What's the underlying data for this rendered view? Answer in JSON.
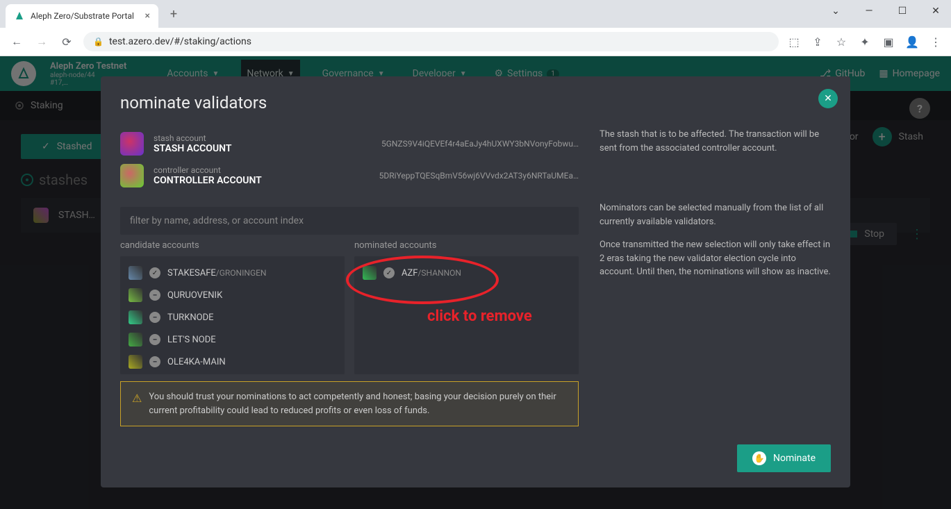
{
  "browser": {
    "tab_title": "Aleph Zero/Substrate Portal",
    "url": "test.azero.dev/#/staking/actions"
  },
  "header": {
    "network_name": "Aleph Zero Testnet",
    "node_name": "aleph-node/44",
    "block_number": "#17,…",
    "nav": {
      "accounts": "Accounts",
      "network": "Network",
      "governance": "Governance",
      "developer": "Developer",
      "settings": "Settings",
      "settings_badge": "1"
    },
    "right": {
      "github": "GitHub",
      "homepage": "Homepage"
    }
  },
  "subnav": {
    "staking": "Staking"
  },
  "page": {
    "stashed_btn": "Stashed",
    "stash_btn": "Stash",
    "or_label": "or",
    "stashes_label": "stashes",
    "stash_name": "STASH…",
    "stop_btn": "Stop"
  },
  "modal": {
    "title": "nominate validators",
    "stash": {
      "sublabel": "stash account",
      "mainlabel": "STASH ACCOUNT",
      "addr": "5GNZS9V4iQEVEf4r4aEaJy4hUXWY3bNVonyFobwu…"
    },
    "controller": {
      "sublabel": "controller account",
      "mainlabel": "CONTROLLER ACCOUNT",
      "addr": "5DRiYeppTQESqBmV56wj6VVvdx2AT3y6NRTaUMEa…"
    },
    "desc1": "The stash that is to be affected. The transaction will be sent from the associated controller account.",
    "desc2": "Nominators can be selected manually from the list of all currently available validators.",
    "desc3": "Once transmitted the new selection will only take effect in 2 eras taking the new validator election cycle into account. Until then, the nominations will show as inactive.",
    "filter_placeholder": "filter by name, address, or account index",
    "candidate_title": "candidate accounts",
    "nominated_title": "nominated accounts",
    "candidates": [
      {
        "name": "STAKESAFE",
        "sub": "/GRONINGEN",
        "color": "#68a",
        "check": true
      },
      {
        "name": "QURUOVENIK",
        "sub": "",
        "color": "#7b4",
        "check": false
      },
      {
        "name": "TURKNODE",
        "sub": "",
        "color": "#3c8",
        "check": false
      },
      {
        "name": "LET'S NODE",
        "sub": "",
        "color": "#4a4",
        "check": false
      },
      {
        "name": "OLE4KA-MAIN",
        "sub": "",
        "color": "#aa2",
        "check": false
      }
    ],
    "nominated": [
      {
        "name": "AZF",
        "sub": "/SHANNON",
        "color": "#3b5"
      }
    ],
    "warning": "You should trust your nominations to act competently and honest; basing your decision purely on their current profitability could lead to reduced profits or even loss of funds.",
    "nominate_btn": "Nominate"
  },
  "annotation": {
    "click_to_remove": "click to remove"
  }
}
